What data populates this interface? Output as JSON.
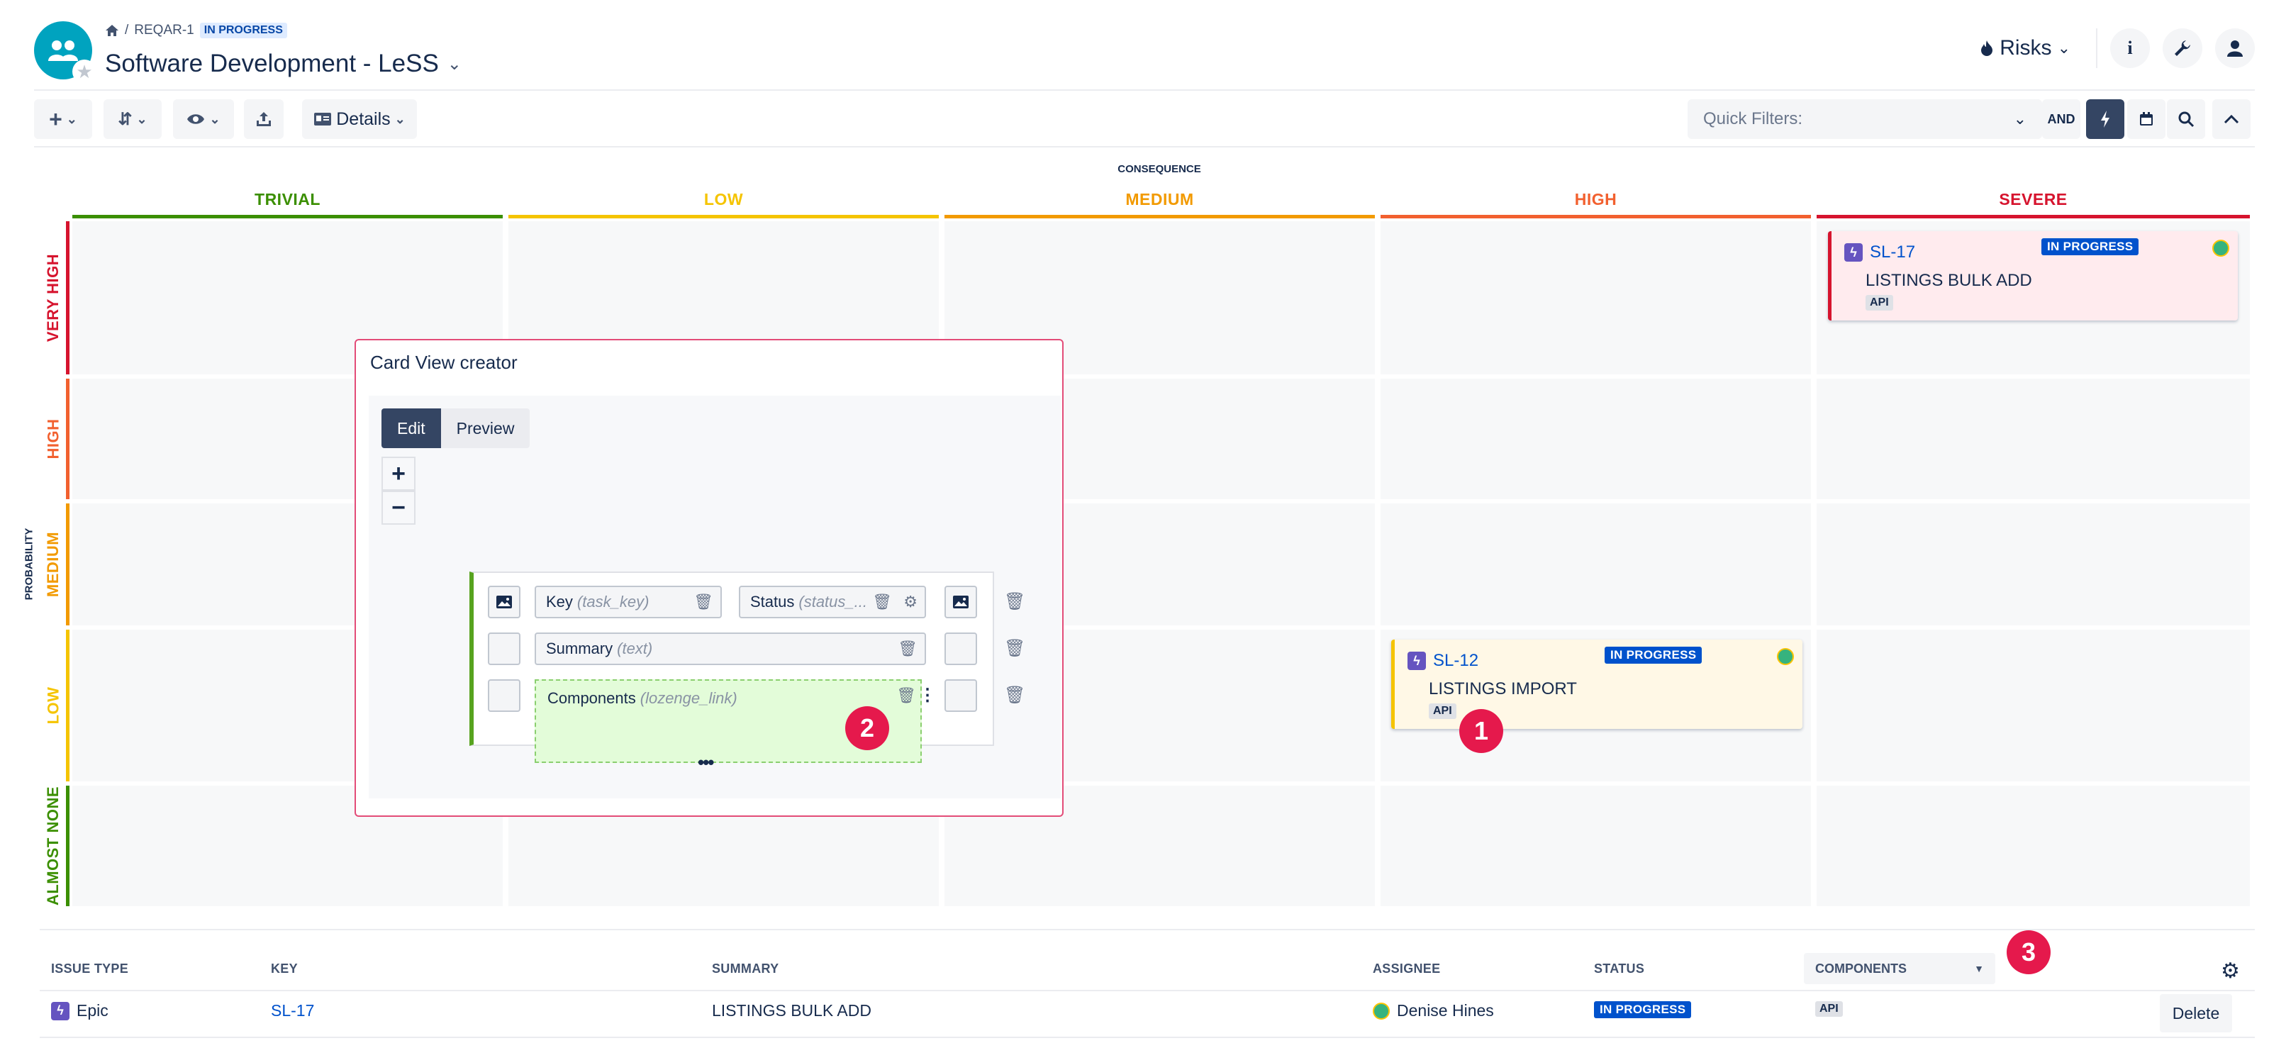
{
  "header": {
    "breadcrumb_project": "REQAR-1",
    "breadcrumb_status": "IN PROGRESS",
    "title": "Software Development - LeSS",
    "risks_label": "Risks"
  },
  "toolbar": {
    "details_label": "Details",
    "quick_filters_label": "Quick Filters:",
    "and_label": "AND"
  },
  "matrix": {
    "consequence_label": "CONSEQUENCE",
    "probability_label": "PROBABILITY",
    "columns": [
      {
        "label": "TRIVIAL",
        "color": "#3b8f00"
      },
      {
        "label": "LOW",
        "color": "#f5c400"
      },
      {
        "label": "MEDIUM",
        "color": "#f29a00"
      },
      {
        "label": "HIGH",
        "color": "#f2602f"
      },
      {
        "label": "SEVERE",
        "color": "#d6142e"
      }
    ],
    "rows": [
      {
        "label": "VERY HIGH",
        "color": "#d6142e"
      },
      {
        "label": "HIGH",
        "color": "#f2602f"
      },
      {
        "label": "MEDIUM",
        "color": "#f29a00"
      },
      {
        "label": "LOW",
        "color": "#f5c400"
      },
      {
        "label": "ALMOST NONE",
        "color": "#3b8f00"
      }
    ]
  },
  "cards": [
    {
      "key": "SL-17",
      "status": "IN PROGRESS",
      "summary": "LISTINGS BULK ADD",
      "component": "API"
    },
    {
      "key": "SL-12",
      "status": "IN PROGRESS",
      "summary": "LISTINGS IMPORT",
      "component": "API"
    }
  ],
  "creator": {
    "title": "Card View creator",
    "tab_edit": "Edit",
    "tab_preview": "Preview",
    "zoom_in": "+",
    "zoom_out": "−",
    "fields": {
      "key_label": "Key",
      "key_hint": "(task_key)",
      "status_label": "Status",
      "status_hint": "(status_...",
      "summary_label": "Summary",
      "summary_hint": "(text)",
      "components_label": "Components",
      "components_hint": "(lozenge_link)"
    }
  },
  "badges": [
    "1",
    "2",
    "3"
  ],
  "table": {
    "headers": {
      "issue_type": "ISSUE TYPE",
      "key": "KEY",
      "summary": "SUMMARY",
      "assignee": "ASSIGNEE",
      "status": "STATUS",
      "components": "COMPONENTS"
    },
    "rows": [
      {
        "issue_type": "Epic",
        "key": "SL-17",
        "summary": "LISTINGS BULK ADD",
        "assignee": "Denise Hines",
        "status": "IN PROGRESS",
        "components": "API",
        "action": "Delete"
      }
    ]
  }
}
